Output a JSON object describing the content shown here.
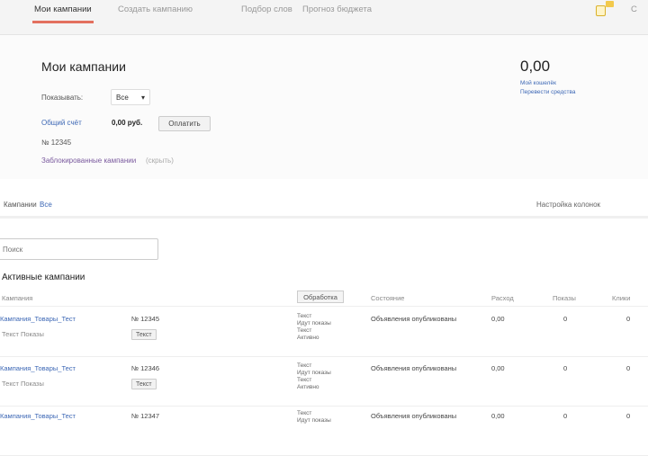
{
  "nav": {
    "tabs": [
      "Мои кампании",
      "Создать кампанию",
      "Подбор слов",
      "Прогноз бюджета"
    ],
    "right_label": "С"
  },
  "header": {
    "title": "Мои кампании",
    "show_label": "Показывать:",
    "show_select": "Все",
    "total_label": "Общий счёт",
    "total_amount": "0,00 руб.",
    "pay_button": "Оплатить",
    "account_label": "№ 12345",
    "link_label": "Заблокированные кампании",
    "link_suffix": "(скрыть)",
    "balance": "0,00",
    "balance_link1": "Мой кошелёк",
    "balance_link2": "Перевести средства"
  },
  "tabs_row": {
    "tab1": "Кампании",
    "tab2": "Все",
    "right_text": "Настройка колонок"
  },
  "search": {
    "placeholder": "Поиск"
  },
  "section": {
    "title": "Активные кампании"
  },
  "table": {
    "columns": [
      "Кампания",
      "Обработка",
      "Состояние",
      "Расход",
      "Показы",
      "Клики"
    ],
    "rows": [
      {
        "name": "Кампания_Товары_Тест",
        "id": "№ 12345",
        "subtitle": "Текст   Показы",
        "tag": "Текст",
        "status_lines": [
          "Текст",
          "Идут показы",
          "Текст",
          "Активно"
        ],
        "state": "Объявления опубликованы",
        "spend": "0,00",
        "shows": "0",
        "clicks": "0"
      },
      {
        "name": "Кампания_Товары_Тест",
        "id": "№ 12346",
        "subtitle": "Текст   Показы",
        "tag": "Текст",
        "status_lines": [
          "Текст",
          "Идут показы",
          "Текст",
          "Активно"
        ],
        "state": "Объявления опубликованы",
        "spend": "0,00",
        "shows": "0",
        "clicks": "0"
      },
      {
        "name": "Кампания_Товары_Тест",
        "id": "№ 12347",
        "subtitle": "",
        "tag": "",
        "status_lines": [
          "Текст",
          "Идут показы"
        ],
        "state": "Объявления опубликованы",
        "spend": "0,00",
        "shows": "0",
        "clicks": "0"
      }
    ]
  },
  "colors": {
    "accent": "#e3705f",
    "link": "#3c67b5",
    "topbar": "#f4f4f4"
  }
}
